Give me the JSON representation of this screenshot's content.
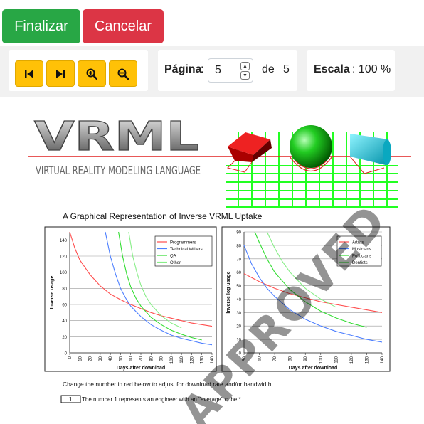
{
  "buttons": {
    "finalize": "Finalizar",
    "cancel": "Cancelar"
  },
  "toolbar": {
    "nav_icons": [
      "first-page-icon",
      "last-page-icon",
      "zoom-in-icon",
      "zoom-out-icon"
    ],
    "page_label": "Página",
    "page_colon": ":",
    "page_value": "5",
    "page_of": "de",
    "page_total": "5",
    "scale_label": "Escala",
    "scale_value": ": 100 %"
  },
  "document": {
    "logo_text": "VRML",
    "logo_subtitle": "VIRTUAL REALITY MODELING LANGUAGE",
    "heading": "A Graphical Representation of Inverse VRML Uptake",
    "instruction": "Change the number in red below to adjust for download rate and/or bandwidth.",
    "number_box": "1",
    "number_note": "The number 1 represents an engineer with an \"average\" cube *",
    "watermark": "APPROVED"
  },
  "colors": {
    "green": "#28a745",
    "red": "#dc3545",
    "yellow": "#ffc107",
    "series_red": "#ff4d4d",
    "series_blue": "#4d7fff",
    "series_green": "#33dd33",
    "series_lightgreen": "#88ee88"
  },
  "chart_data": [
    {
      "type": "line",
      "xlabel": "Days after download",
      "ylabel": "Inverse usage",
      "xlim": [
        0,
        140
      ],
      "ylim": [
        0,
        150
      ],
      "x_ticks": [
        "0",
        "10",
        "20",
        "30",
        "40",
        "50",
        "60",
        "70",
        "80",
        "90",
        "100",
        "110",
        "120",
        "130",
        "140"
      ],
      "y_ticks": [
        "0",
        "20",
        "40",
        "60",
        "80",
        "100",
        "120",
        "140"
      ],
      "legend": "top-right",
      "series": [
        {
          "name": "Programmers",
          "color": "#ff4d4d",
          "x": [
            0,
            5,
            10,
            20,
            30,
            40,
            50,
            60,
            70,
            80,
            90,
            100,
            110,
            120,
            130,
            140
          ],
          "y": [
            150,
            130,
            115,
            97,
            83,
            73,
            66,
            60,
            55,
            50,
            46,
            43,
            40,
            37,
            35,
            33
          ]
        },
        {
          "name": "Technical Writers",
          "color": "#4d7fff",
          "x": [
            35,
            40,
            45,
            50,
            55,
            60,
            70,
            80,
            90,
            100,
            110,
            120,
            130,
            140
          ],
          "y": [
            150,
            120,
            98,
            80,
            68,
            58,
            45,
            35,
            28,
            22,
            18,
            15,
            12,
            10
          ]
        },
        {
          "name": "QA",
          "color": "#33dd33",
          "x": [
            48,
            52,
            56,
            60,
            65,
            70,
            80,
            90,
            100,
            110,
            120,
            130
          ],
          "y": [
            150,
            120,
            98,
            82,
            68,
            58,
            44,
            35,
            28,
            23,
            19,
            16
          ]
        },
        {
          "name": "Other",
          "color": "#88ee88",
          "x": [
            58,
            62,
            66,
            70,
            75,
            80,
            90,
            100,
            110
          ],
          "y": [
            150,
            120,
            100,
            84,
            70,
            60,
            46,
            37,
            31
          ]
        }
      ]
    },
    {
      "type": "line",
      "xlabel": "Days after download",
      "ylabel": "Inverse log usage",
      "xlim": [
        50,
        140
      ],
      "ylim": [
        0,
        90
      ],
      "x_ticks": [
        "50",
        "60",
        "70",
        "80",
        "90",
        "100",
        "110",
        "120",
        "130",
        "140"
      ],
      "y_ticks": [
        "0",
        "10",
        "20",
        "30",
        "40",
        "50",
        "60",
        "70",
        "80",
        "90"
      ],
      "legend": "top-right",
      "series": [
        {
          "name": "Artists",
          "color": "#ff4d4d",
          "x": [
            50,
            60,
            70,
            80,
            90,
            100,
            110,
            120,
            130,
            140
          ],
          "y": [
            59,
            53,
            48,
            44,
            41,
            38,
            36,
            34,
            32,
            30
          ]
        },
        {
          "name": "Musicians",
          "color": "#4d7fff",
          "x": [
            50,
            55,
            60,
            65,
            70,
            80,
            90,
            100,
            110,
            120,
            130,
            140
          ],
          "y": [
            80,
            66,
            56,
            48,
            42,
            32,
            25,
            20,
            16,
            13,
            10,
            8
          ]
        },
        {
          "name": "Politicians",
          "color": "#33dd33",
          "x": [
            57,
            60,
            65,
            70,
            80,
            90,
            100,
            110,
            120,
            130
          ],
          "y": [
            90,
            82,
            70,
            60,
            47,
            38,
            31,
            26,
            22,
            19
          ]
        },
        {
          "name": "Dentists",
          "color": "#88ee88",
          "x": [
            65,
            70,
            75,
            80,
            90,
            100,
            110
          ],
          "y": [
            90,
            78,
            68,
            60,
            48,
            40,
            34
          ]
        }
      ]
    }
  ]
}
